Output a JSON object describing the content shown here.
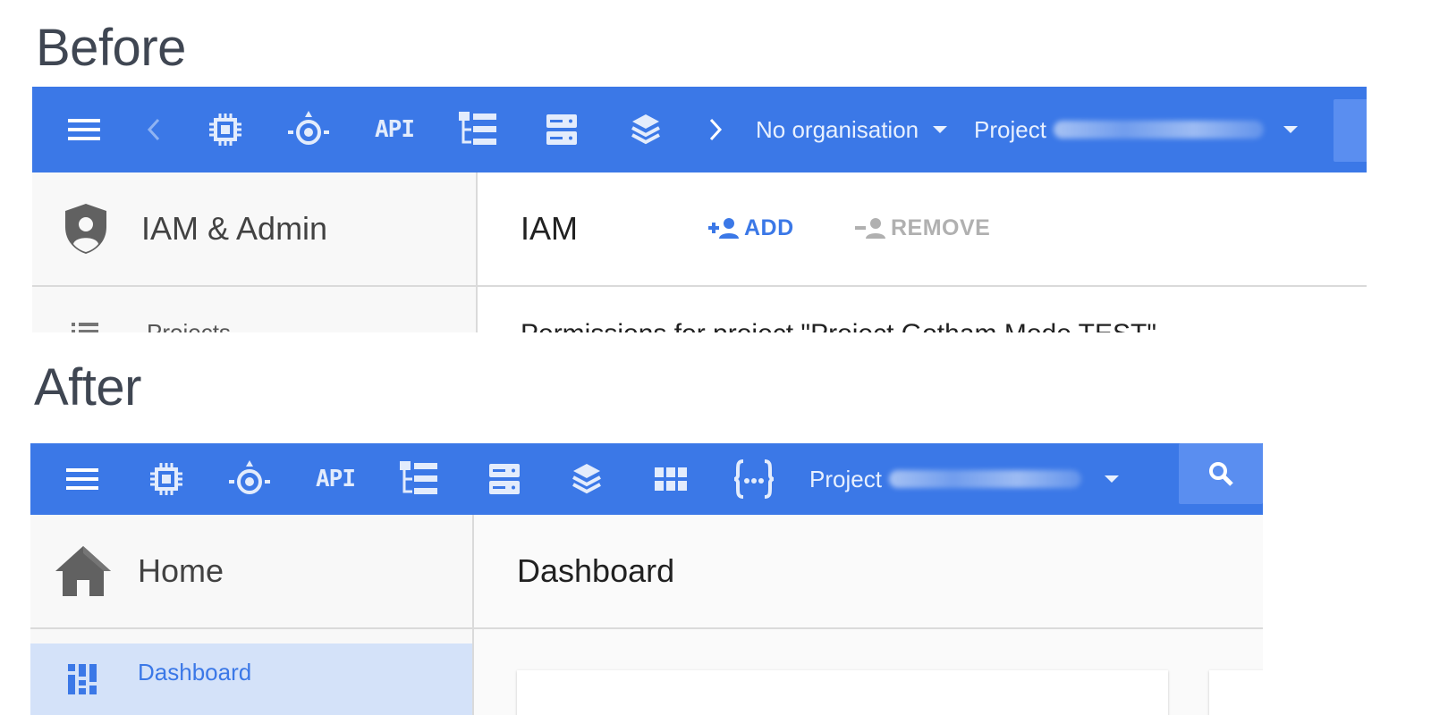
{
  "before": {
    "section_title": "Before",
    "appbar": {
      "icons": [
        "menu-icon",
        "chevron-left-icon",
        "chip-icon",
        "target-icon",
        "api-icon",
        "hierarchy-icon",
        "storage-icon",
        "layers-icon",
        "chevron-right-icon"
      ],
      "api_label": "API",
      "org_dropdown": "No organisation",
      "project_dropdown": "Project",
      "color": "#3b78e7"
    },
    "sidebar": {
      "title": "IAM & Admin",
      "icon": "shield-person-icon",
      "partial_item": "Projects"
    },
    "content": {
      "title": "IAM",
      "add_label": "ADD",
      "remove_label": "REMOVE",
      "partial_text": "Permissions for project \"Project Gotham Mode TEST\""
    }
  },
  "after": {
    "section_title": "After",
    "appbar": {
      "icons": [
        "menu-icon",
        "chip-icon",
        "target-icon",
        "api-icon",
        "hierarchy-icon",
        "storage-icon",
        "layers-icon",
        "apps-grid-icon",
        "code-braces-icon",
        "search-icon"
      ],
      "api_label": "API",
      "project_dropdown": "Project",
      "color": "#3b78e7"
    },
    "sidebar": {
      "title": "Home",
      "icon": "home-icon",
      "active_item": "Dashboard",
      "active_item_icon": "dashboard-icon"
    },
    "content": {
      "title": "Dashboard"
    }
  },
  "colors": {
    "primary_blue": "#3b78e7",
    "active_nav_bg": "#d4e2f9",
    "disabled_gray": "#b0b0b0"
  }
}
